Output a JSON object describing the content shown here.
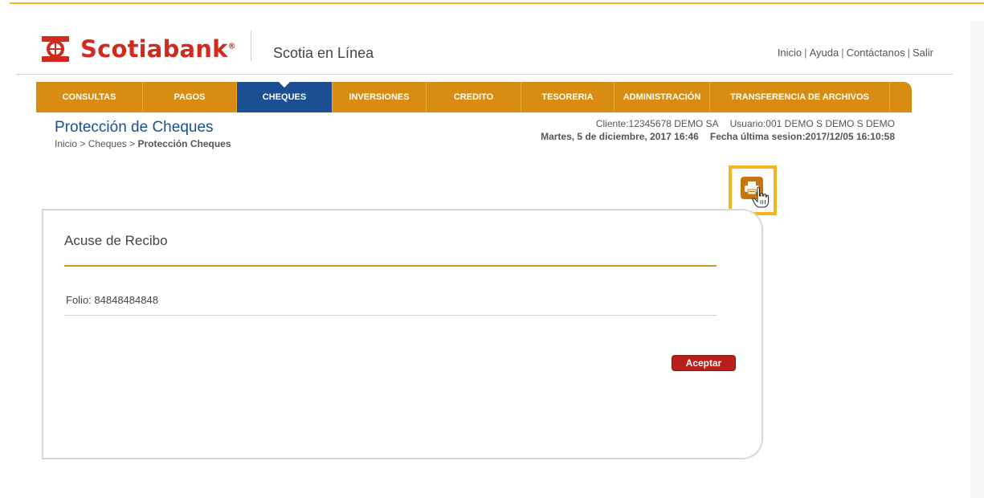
{
  "header": {
    "brand": "Scotiabank",
    "brand_mark": "®",
    "product": "Scotia en Línea",
    "links": [
      "Inicio",
      "Ayuda",
      "Contáctanos",
      "Salir"
    ],
    "link_separator": "|"
  },
  "nav": {
    "items": [
      {
        "label": "CONSULTAS",
        "active": false
      },
      {
        "label": "PAGOS",
        "active": false
      },
      {
        "label": "CHEQUES",
        "active": true
      },
      {
        "label": "INVERSIONES",
        "active": false
      },
      {
        "label": "CREDITO",
        "active": false
      },
      {
        "label": "TESORERIA",
        "active": false
      },
      {
        "label": "ADMINISTRACIÓN",
        "active": false
      },
      {
        "label": "TRANSFERENCIA DE ARCHIVOS",
        "active": false
      }
    ]
  },
  "page": {
    "title": "Protección de Cheques",
    "breadcrumb": {
      "items": [
        "Inicio",
        "Cheques"
      ],
      "current": "Protección Cheques",
      "separator": ">"
    }
  },
  "session": {
    "cliente": "Cliente:12345678  DEMO SA",
    "usuario": "Usuario:001 DEMO S DEMO S DEMO",
    "fecha": "Martes, 5 de diciembre, 2017 16:46",
    "ultima_sesion": "Fecha última sesion:2017/12/05 16:10:58"
  },
  "print": {
    "icon": "printer-icon",
    "cursor": "hand-pointer-icon"
  },
  "card": {
    "title": "Acuse de Recibo",
    "folio": "Folio: 84848484848",
    "accept_label": "Aceptar"
  },
  "colors": {
    "brand_red": "#d12b1f",
    "nav_orange": "#d98c12",
    "nav_active_blue": "#1c4e93",
    "title_blue": "#1c4e93",
    "highlight_yellow": "#f2b51b",
    "accept_red": "#b81f1a"
  }
}
